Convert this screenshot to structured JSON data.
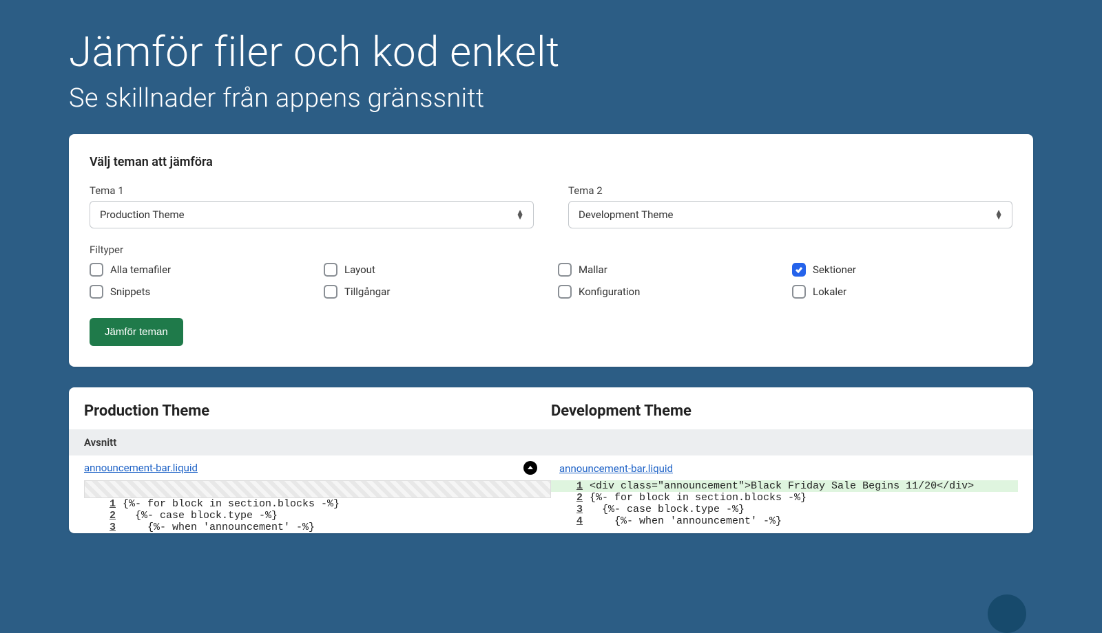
{
  "hero": {
    "title": "Jämför filer och kod enkelt",
    "subtitle": "Se skillnader från appens gränssnitt"
  },
  "compare": {
    "panel_title": "Välj teman att jämföra",
    "theme1_label": "Tema 1",
    "theme1_value": "Production Theme",
    "theme2_label": "Tema 2",
    "theme2_value": "Development Theme",
    "filetypes_label": "Filtyper",
    "checkboxes": [
      {
        "label": "Alla temafiler",
        "checked": false
      },
      {
        "label": "Layout",
        "checked": false
      },
      {
        "label": "Mallar",
        "checked": false
      },
      {
        "label": "Sektioner",
        "checked": true
      },
      {
        "label": "Snippets",
        "checked": false
      },
      {
        "label": "Tillgångar",
        "checked": false
      },
      {
        "label": "Konfiguration",
        "checked": false
      },
      {
        "label": "Lokaler",
        "checked": false
      }
    ],
    "button": "Jämför teman"
  },
  "diff": {
    "left_title": "Production Theme",
    "right_title": "Development Theme",
    "section_label": "Avsnitt",
    "left_file": "announcement-bar.liquid",
    "right_file": "announcement-bar.liquid",
    "left_code": [
      {
        "n": "1",
        "text": "{%- for block in section.blocks -%}"
      },
      {
        "n": "2",
        "text": "  {%- case block.type -%}"
      },
      {
        "n": "3",
        "text": "    {%- when 'announcement' -%}"
      }
    ],
    "right_code": [
      {
        "n": "1",
        "text": "<div class=\"announcement\">Black Friday Sale Begins 11/20</div>",
        "added": true
      },
      {
        "n": "2",
        "text": "{%- for block in section.blocks -%}"
      },
      {
        "n": "3",
        "text": "  {%- case block.type -%}"
      },
      {
        "n": "4",
        "text": "    {%- when 'announcement' -%}"
      }
    ]
  }
}
